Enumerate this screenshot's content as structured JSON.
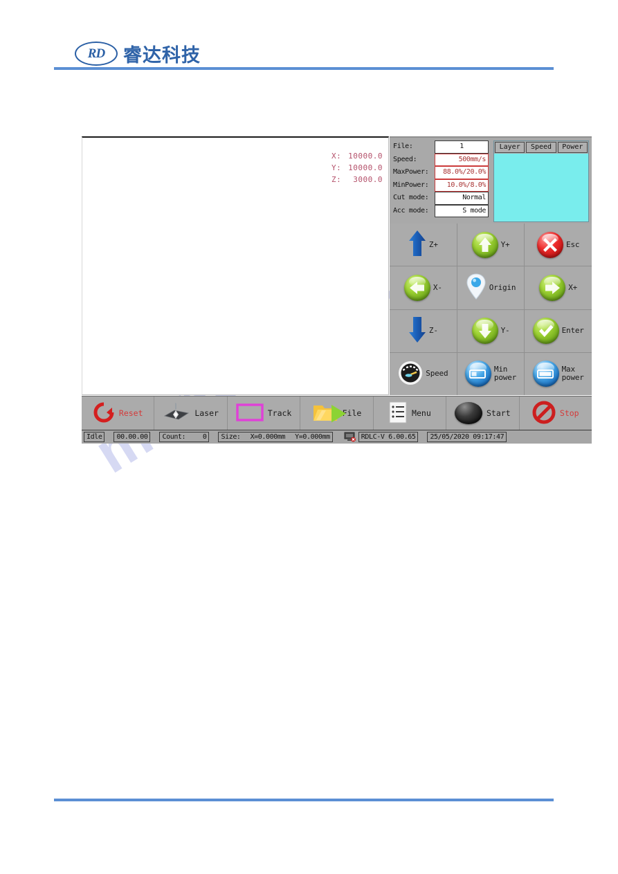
{
  "header": {
    "logo_mark": "RD",
    "logo_text": "睿达科技"
  },
  "watermark": {
    "text": "manualslib.com"
  },
  "device": {
    "coordinates": [
      {
        "axis": "X:",
        "value": "10000.0"
      },
      {
        "axis": "Y:",
        "value": "10000.0"
      },
      {
        "axis": "Z:",
        "value": "3000.0"
      }
    ],
    "parameters": [
      {
        "label": "File:",
        "value": "1",
        "style": "black-center"
      },
      {
        "label": "Speed:",
        "value": "500mm/s",
        "style": "red"
      },
      {
        "label": "MaxPower:",
        "value": "88.0%/20.0%",
        "style": "red"
      },
      {
        "label": "MinPower:",
        "value": "10.0%/8.0%",
        "style": "red"
      },
      {
        "label": "Cut mode:",
        "value": "Normal",
        "style": "black"
      },
      {
        "label": "Acc mode:",
        "value": "S mode",
        "style": "black"
      }
    ],
    "layer_table": {
      "columns": [
        "Layer",
        "Speed",
        "Power"
      ],
      "rows": [],
      "background_color": "#79eded"
    },
    "keypad": [
      {
        "label": "Z+",
        "icon": "arrow-up-blue-icon"
      },
      {
        "label": "Y+",
        "icon": "arrow-up-green-orb-icon"
      },
      {
        "label": "Esc",
        "icon": "close-x-red-orb-icon"
      },
      {
        "label": "X-",
        "icon": "arrow-left-green-orb-icon"
      },
      {
        "label": "Origin",
        "icon": "location-pin-icon"
      },
      {
        "label": "X+",
        "icon": "arrow-right-green-orb-icon"
      },
      {
        "label": "Z-",
        "icon": "arrow-down-blue-icon"
      },
      {
        "label": "Y-",
        "icon": "arrow-down-green-orb-icon"
      },
      {
        "label": "Enter",
        "icon": "check-green-orb-icon"
      },
      {
        "label": "Speed",
        "icon": "speedometer-icon"
      },
      {
        "label": "Min\npower",
        "icon": "battery-low-blue-orb-icon"
      },
      {
        "label": "Max\npower",
        "icon": "battery-full-blue-orb-icon"
      }
    ],
    "toolbar": [
      {
        "label": "Reset",
        "icon": "reset-circular-arrow-icon",
        "color": "#d43a3a"
      },
      {
        "label": "Laser",
        "icon": "laser-head-icon",
        "color": "#1a1a1a"
      },
      {
        "label": "Track",
        "icon": "rectangle-outline-icon",
        "color": "#1a1a1a"
      },
      {
        "label": "File",
        "icon": "folder-icon",
        "color": "#1a1a1a"
      },
      {
        "label": "Menu",
        "icon": "list-document-icon",
        "color": "#1a1a1a"
      },
      {
        "label": "Start",
        "icon": "play-black-orb-icon",
        "color": "#1a1a1a"
      },
      {
        "label": "Stop",
        "icon": "stop-prohibition-icon",
        "color": "#d43a3a"
      }
    ],
    "statusbar": {
      "state": "Idle",
      "timer": "00.00.00",
      "count_label": "Count:",
      "count_value": "0",
      "size_label": "Size:",
      "size_x": "X=0.000mm",
      "size_y": "Y=0.000mm",
      "connection_icon": "display-disconnected-icon",
      "firmware": "RDLC-V 6.00.65",
      "datetime": "25/05/2020 09:17:47"
    }
  }
}
